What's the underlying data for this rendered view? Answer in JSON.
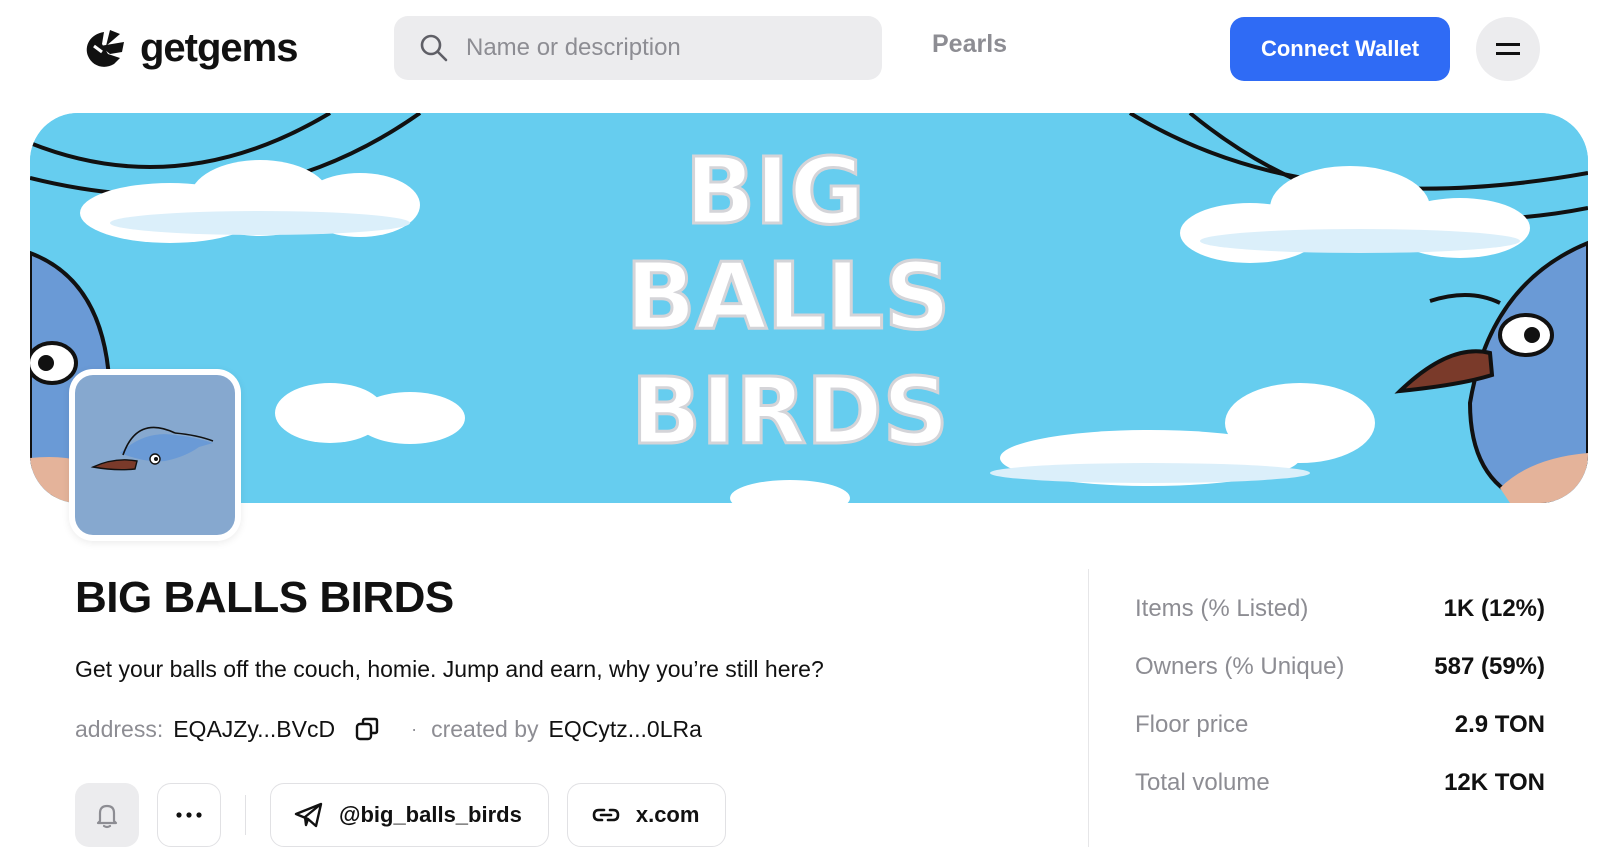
{
  "header": {
    "logo_text": "getgems",
    "search_placeholder": "Name or description",
    "nav_pearls": "Pearls",
    "connect_wallet": "Connect Wallet"
  },
  "banner": {
    "title_lines": [
      "BIG",
      "BALLS",
      "BIRDS"
    ],
    "sky_color": "#66cdef"
  },
  "collection": {
    "name": "BIG BALLS BIRDS",
    "description": "Get your balls off the couch, homie. Jump and earn, why you’re still here?",
    "address_label": "address:",
    "address_value": "EQAJZy...BVcD",
    "created_by_label": "created by",
    "created_by_value": "EQCytz...0LRa",
    "separator": "·"
  },
  "actions": {
    "telegram_label": "@big_balls_birds",
    "website_label": "x.com",
    "more_label": "···"
  },
  "stats": [
    {
      "label": "Items (% Listed)",
      "value": "1K (12%)"
    },
    {
      "label": "Owners (% Unique)",
      "value": "587 (59%)"
    },
    {
      "label": "Floor price",
      "value": "2.9 TON"
    },
    {
      "label": "Total volume",
      "value": "12K TON"
    }
  ],
  "colors": {
    "accent": "#2f6bf5",
    "muted_text": "#8d8d93",
    "input_bg": "#ececee"
  }
}
